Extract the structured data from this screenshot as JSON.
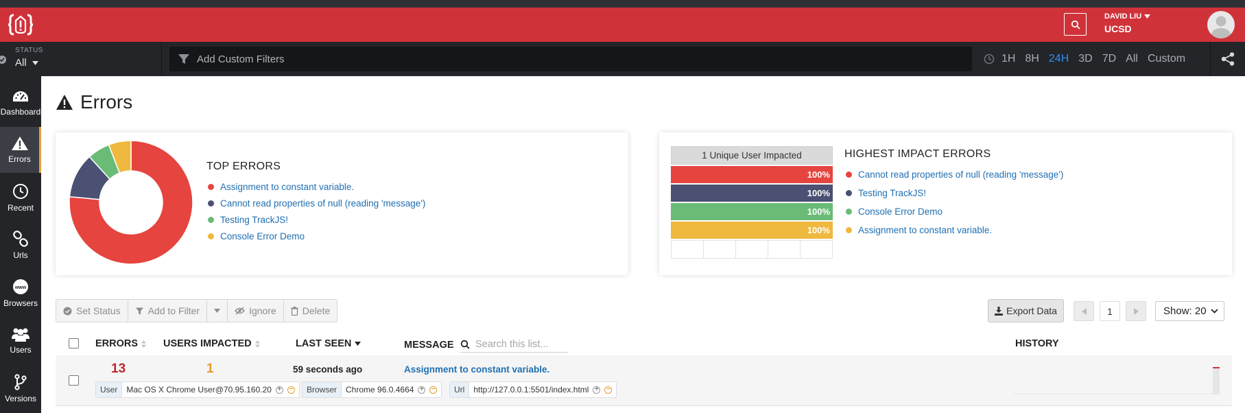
{
  "header": {
    "user_name": "DAVID LIU",
    "org_name": "UCSD"
  },
  "filterbar": {
    "status_label": "STATUS",
    "status_value": "All",
    "custom_filter_placeholder": "Add Custom Filters",
    "ranges": [
      "1H",
      "8H",
      "24H",
      "3D",
      "7D",
      "All",
      "Custom"
    ],
    "active_range": "24H"
  },
  "sidebar": {
    "items": [
      {
        "label": "Dashboard",
        "icon": "dashboard-icon"
      },
      {
        "label": "Errors",
        "icon": "warning-icon"
      },
      {
        "label": "Recent",
        "icon": "clock-icon"
      },
      {
        "label": "Urls",
        "icon": "link-icon"
      },
      {
        "label": "Browsers",
        "icon": "www-icon"
      },
      {
        "label": "Users",
        "icon": "users-icon"
      },
      {
        "label": "Versions",
        "icon": "branch-icon"
      }
    ],
    "active": "Errors"
  },
  "page": {
    "title": "Errors"
  },
  "top_errors": {
    "title": "TOP ERRORS",
    "items": [
      {
        "label": "Assignment to constant variable.",
        "color": "#e5443f"
      },
      {
        "label": "Cannot read properties of null (reading 'message')",
        "color": "#4a5173"
      },
      {
        "label": "Testing TrackJS!",
        "color": "#6abb76"
      },
      {
        "label": "Console Error Demo",
        "color": "#efb83e"
      }
    ]
  },
  "chart_data": {
    "type": "pie",
    "title": "TOP ERRORS",
    "categories": [
      "Assignment to constant variable.",
      "Cannot read properties of null (reading 'message')",
      "Testing TrackJS!",
      "Console Error Demo"
    ],
    "values": [
      13,
      2,
      1,
      1
    ],
    "colors": [
      "#e5443f",
      "#4a5173",
      "#6abb76",
      "#efb83e"
    ]
  },
  "highest_impact": {
    "title": "HIGHEST IMPACT ERRORS",
    "table_header": "1 Unique User Impacted",
    "bars": [
      {
        "label": "100%",
        "fraction": 1.0,
        "color": "#e5443f"
      },
      {
        "label": "100%",
        "fraction": 1.0,
        "color": "#4a5173"
      },
      {
        "label": "100%",
        "fraction": 1.0,
        "color": "#6abb76"
      },
      {
        "label": "100%",
        "fraction": 1.0,
        "color": "#efb83e"
      }
    ],
    "items": [
      {
        "label": "Cannot read properties of null (reading 'message')",
        "color": "#e5443f"
      },
      {
        "label": "Testing TrackJS!",
        "color": "#4a5173"
      },
      {
        "label": "Console Error Demo",
        "color": "#6abb76"
      },
      {
        "label": "Assignment to constant variable.",
        "color": "#efb83e"
      }
    ]
  },
  "toolbar": {
    "set_status": "Set Status",
    "add_to_filter": "Add to Filter",
    "ignore": "Ignore",
    "delete": "Delete",
    "export": "Export Data",
    "page_number": "1",
    "show": "Show: 20"
  },
  "table": {
    "columns": {
      "errors": "ERRORS",
      "users": "USERS IMPACTED",
      "last_seen": "LAST SEEN",
      "message": "MESSAGE",
      "history": "HISTORY"
    },
    "search_placeholder": "Search this list...",
    "rows": [
      {
        "errors": "13",
        "users": "1",
        "last_seen": "59 seconds ago",
        "message": "Assignment to constant variable.",
        "user_key": "User",
        "user_val": "Mac OS X Chrome User@70.95.160.20",
        "browser_key": "Browser",
        "browser_val": "Chrome 96.0.4664",
        "url_key": "Url",
        "url_val": "http://127.0.0.1:5501/index.html"
      }
    ]
  },
  "colors": {
    "brand_red": "#d0323a",
    "dark_bg": "#232529",
    "link_blue": "#1f6fb2",
    "active_range": "#2f8ff0"
  }
}
